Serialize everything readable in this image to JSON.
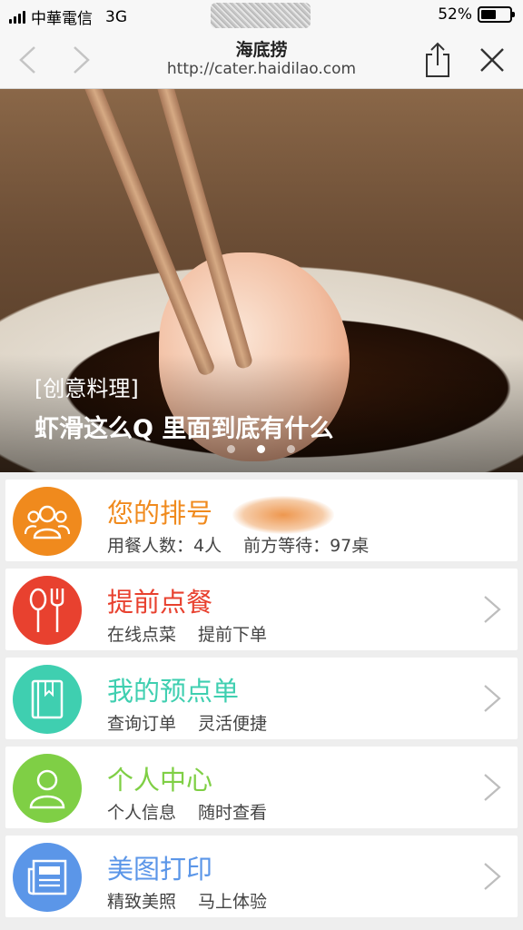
{
  "status_bar": {
    "carrier": "中華電信",
    "network": "3G",
    "battery_percent": "52%",
    "battery_level": 0.52
  },
  "nav": {
    "title": "海底捞",
    "url": "http://cater.haidilao.com",
    "back_icon": "chevron-left-icon",
    "forward_icon": "chevron-right-icon",
    "share_icon": "share-icon",
    "close_icon": "close-icon"
  },
  "banner": {
    "tag": "[创意料理]",
    "headline": "虾滑这么Q 里面到底有什么",
    "dot_count": 3,
    "active_dot": 2
  },
  "cards": [
    {
      "title": "您的排号",
      "sub1": "用餐人数：4人",
      "sub2": "前方等待：97桌",
      "color": "#f08a1d",
      "icon": "people-icon",
      "has_chevron": false
    },
    {
      "title": "提前点餐",
      "sub1": "在线点菜",
      "sub2": "提前下单",
      "color": "#e8412f",
      "icon": "spoon-fork-icon",
      "has_chevron": true
    },
    {
      "title": "我的预点单",
      "sub1": "查询订单",
      "sub2": "灵活便捷",
      "color": "#3fcfb0",
      "icon": "book-icon",
      "has_chevron": true
    },
    {
      "title": "个人中心",
      "sub1": "个人信息",
      "sub2": "随时查看",
      "color": "#7fcf45",
      "icon": "user-icon",
      "has_chevron": true
    },
    {
      "title": "美图打印",
      "sub1": "精致美照",
      "sub2": "马上体验",
      "color": "#5b96e8",
      "icon": "newspaper-icon",
      "has_chevron": true
    }
  ]
}
